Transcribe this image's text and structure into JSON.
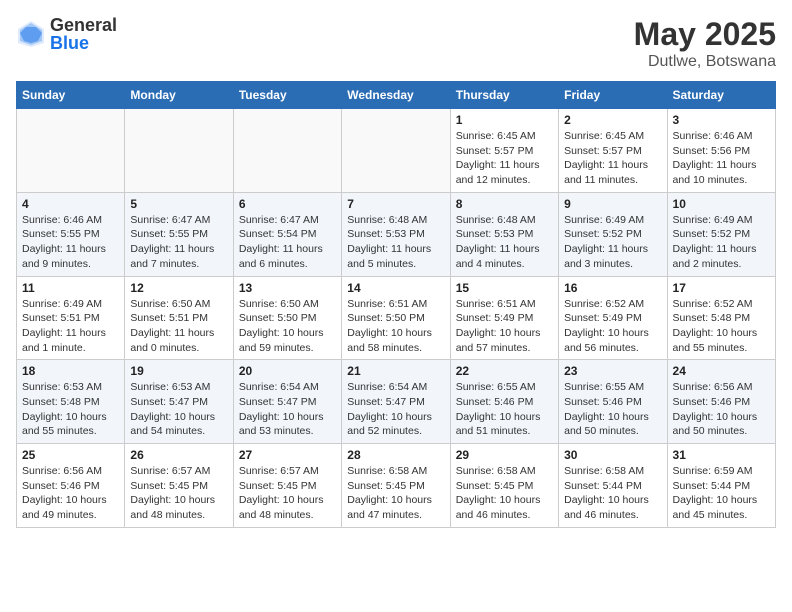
{
  "header": {
    "logo_general": "General",
    "logo_blue": "Blue",
    "month": "May 2025",
    "location": "Dutlwe, Botswana"
  },
  "weekdays": [
    "Sunday",
    "Monday",
    "Tuesday",
    "Wednesday",
    "Thursday",
    "Friday",
    "Saturday"
  ],
  "weeks": [
    [
      {
        "day": "",
        "info": ""
      },
      {
        "day": "",
        "info": ""
      },
      {
        "day": "",
        "info": ""
      },
      {
        "day": "",
        "info": ""
      },
      {
        "day": "1",
        "info": "Sunrise: 6:45 AM\nSunset: 5:57 PM\nDaylight: 11 hours and 12 minutes."
      },
      {
        "day": "2",
        "info": "Sunrise: 6:45 AM\nSunset: 5:57 PM\nDaylight: 11 hours and 11 minutes."
      },
      {
        "day": "3",
        "info": "Sunrise: 6:46 AM\nSunset: 5:56 PM\nDaylight: 11 hours and 10 minutes."
      }
    ],
    [
      {
        "day": "4",
        "info": "Sunrise: 6:46 AM\nSunset: 5:55 PM\nDaylight: 11 hours and 9 minutes."
      },
      {
        "day": "5",
        "info": "Sunrise: 6:47 AM\nSunset: 5:55 PM\nDaylight: 11 hours and 7 minutes."
      },
      {
        "day": "6",
        "info": "Sunrise: 6:47 AM\nSunset: 5:54 PM\nDaylight: 11 hours and 6 minutes."
      },
      {
        "day": "7",
        "info": "Sunrise: 6:48 AM\nSunset: 5:53 PM\nDaylight: 11 hours and 5 minutes."
      },
      {
        "day": "8",
        "info": "Sunrise: 6:48 AM\nSunset: 5:53 PM\nDaylight: 11 hours and 4 minutes."
      },
      {
        "day": "9",
        "info": "Sunrise: 6:49 AM\nSunset: 5:52 PM\nDaylight: 11 hours and 3 minutes."
      },
      {
        "day": "10",
        "info": "Sunrise: 6:49 AM\nSunset: 5:52 PM\nDaylight: 11 hours and 2 minutes."
      }
    ],
    [
      {
        "day": "11",
        "info": "Sunrise: 6:49 AM\nSunset: 5:51 PM\nDaylight: 11 hours and 1 minute."
      },
      {
        "day": "12",
        "info": "Sunrise: 6:50 AM\nSunset: 5:51 PM\nDaylight: 11 hours and 0 minutes."
      },
      {
        "day": "13",
        "info": "Sunrise: 6:50 AM\nSunset: 5:50 PM\nDaylight: 10 hours and 59 minutes."
      },
      {
        "day": "14",
        "info": "Sunrise: 6:51 AM\nSunset: 5:50 PM\nDaylight: 10 hours and 58 minutes."
      },
      {
        "day": "15",
        "info": "Sunrise: 6:51 AM\nSunset: 5:49 PM\nDaylight: 10 hours and 57 minutes."
      },
      {
        "day": "16",
        "info": "Sunrise: 6:52 AM\nSunset: 5:49 PM\nDaylight: 10 hours and 56 minutes."
      },
      {
        "day": "17",
        "info": "Sunrise: 6:52 AM\nSunset: 5:48 PM\nDaylight: 10 hours and 55 minutes."
      }
    ],
    [
      {
        "day": "18",
        "info": "Sunrise: 6:53 AM\nSunset: 5:48 PM\nDaylight: 10 hours and 55 minutes."
      },
      {
        "day": "19",
        "info": "Sunrise: 6:53 AM\nSunset: 5:47 PM\nDaylight: 10 hours and 54 minutes."
      },
      {
        "day": "20",
        "info": "Sunrise: 6:54 AM\nSunset: 5:47 PM\nDaylight: 10 hours and 53 minutes."
      },
      {
        "day": "21",
        "info": "Sunrise: 6:54 AM\nSunset: 5:47 PM\nDaylight: 10 hours and 52 minutes."
      },
      {
        "day": "22",
        "info": "Sunrise: 6:55 AM\nSunset: 5:46 PM\nDaylight: 10 hours and 51 minutes."
      },
      {
        "day": "23",
        "info": "Sunrise: 6:55 AM\nSunset: 5:46 PM\nDaylight: 10 hours and 50 minutes."
      },
      {
        "day": "24",
        "info": "Sunrise: 6:56 AM\nSunset: 5:46 PM\nDaylight: 10 hours and 50 minutes."
      }
    ],
    [
      {
        "day": "25",
        "info": "Sunrise: 6:56 AM\nSunset: 5:46 PM\nDaylight: 10 hours and 49 minutes."
      },
      {
        "day": "26",
        "info": "Sunrise: 6:57 AM\nSunset: 5:45 PM\nDaylight: 10 hours and 48 minutes."
      },
      {
        "day": "27",
        "info": "Sunrise: 6:57 AM\nSunset: 5:45 PM\nDaylight: 10 hours and 48 minutes."
      },
      {
        "day": "28",
        "info": "Sunrise: 6:58 AM\nSunset: 5:45 PM\nDaylight: 10 hours and 47 minutes."
      },
      {
        "day": "29",
        "info": "Sunrise: 6:58 AM\nSunset: 5:45 PM\nDaylight: 10 hours and 46 minutes."
      },
      {
        "day": "30",
        "info": "Sunrise: 6:58 AM\nSunset: 5:44 PM\nDaylight: 10 hours and 46 minutes."
      },
      {
        "day": "31",
        "info": "Sunrise: 6:59 AM\nSunset: 5:44 PM\nDaylight: 10 hours and 45 minutes."
      }
    ]
  ]
}
